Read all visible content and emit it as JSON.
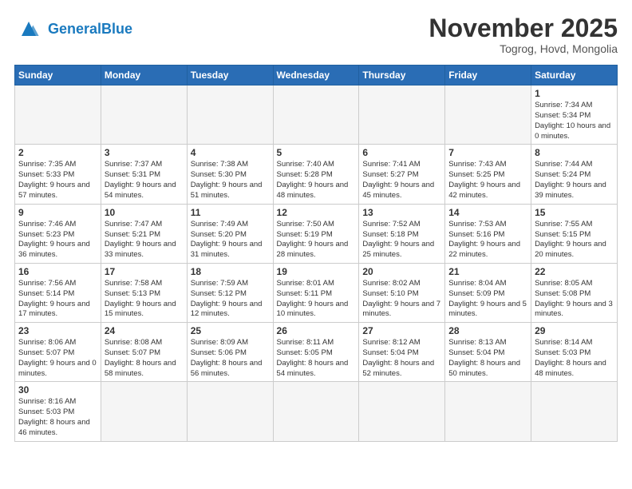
{
  "header": {
    "logo_general": "General",
    "logo_blue": "Blue",
    "month_title": "November 2025",
    "location": "Togrog, Hovd, Mongolia"
  },
  "weekdays": [
    "Sunday",
    "Monday",
    "Tuesday",
    "Wednesday",
    "Thursday",
    "Friday",
    "Saturday"
  ],
  "days": [
    {
      "num": "",
      "info": "",
      "empty": true
    },
    {
      "num": "",
      "info": "",
      "empty": true
    },
    {
      "num": "",
      "info": "",
      "empty": true
    },
    {
      "num": "",
      "info": "",
      "empty": true
    },
    {
      "num": "",
      "info": "",
      "empty": true
    },
    {
      "num": "",
      "info": "",
      "empty": true
    },
    {
      "num": "1",
      "info": "Sunrise: 7:34 AM\nSunset: 5:34 PM\nDaylight: 10 hours and 0 minutes."
    },
    {
      "num": "2",
      "info": "Sunrise: 7:35 AM\nSunset: 5:33 PM\nDaylight: 9 hours and 57 minutes."
    },
    {
      "num": "3",
      "info": "Sunrise: 7:37 AM\nSunset: 5:31 PM\nDaylight: 9 hours and 54 minutes."
    },
    {
      "num": "4",
      "info": "Sunrise: 7:38 AM\nSunset: 5:30 PM\nDaylight: 9 hours and 51 minutes."
    },
    {
      "num": "5",
      "info": "Sunrise: 7:40 AM\nSunset: 5:28 PM\nDaylight: 9 hours and 48 minutes."
    },
    {
      "num": "6",
      "info": "Sunrise: 7:41 AM\nSunset: 5:27 PM\nDaylight: 9 hours and 45 minutes."
    },
    {
      "num": "7",
      "info": "Sunrise: 7:43 AM\nSunset: 5:25 PM\nDaylight: 9 hours and 42 minutes."
    },
    {
      "num": "8",
      "info": "Sunrise: 7:44 AM\nSunset: 5:24 PM\nDaylight: 9 hours and 39 minutes."
    },
    {
      "num": "9",
      "info": "Sunrise: 7:46 AM\nSunset: 5:23 PM\nDaylight: 9 hours and 36 minutes."
    },
    {
      "num": "10",
      "info": "Sunrise: 7:47 AM\nSunset: 5:21 PM\nDaylight: 9 hours and 33 minutes."
    },
    {
      "num": "11",
      "info": "Sunrise: 7:49 AM\nSunset: 5:20 PM\nDaylight: 9 hours and 31 minutes."
    },
    {
      "num": "12",
      "info": "Sunrise: 7:50 AM\nSunset: 5:19 PM\nDaylight: 9 hours and 28 minutes."
    },
    {
      "num": "13",
      "info": "Sunrise: 7:52 AM\nSunset: 5:18 PM\nDaylight: 9 hours and 25 minutes."
    },
    {
      "num": "14",
      "info": "Sunrise: 7:53 AM\nSunset: 5:16 PM\nDaylight: 9 hours and 22 minutes."
    },
    {
      "num": "15",
      "info": "Sunrise: 7:55 AM\nSunset: 5:15 PM\nDaylight: 9 hours and 20 minutes."
    },
    {
      "num": "16",
      "info": "Sunrise: 7:56 AM\nSunset: 5:14 PM\nDaylight: 9 hours and 17 minutes."
    },
    {
      "num": "17",
      "info": "Sunrise: 7:58 AM\nSunset: 5:13 PM\nDaylight: 9 hours and 15 minutes."
    },
    {
      "num": "18",
      "info": "Sunrise: 7:59 AM\nSunset: 5:12 PM\nDaylight: 9 hours and 12 minutes."
    },
    {
      "num": "19",
      "info": "Sunrise: 8:01 AM\nSunset: 5:11 PM\nDaylight: 9 hours and 10 minutes."
    },
    {
      "num": "20",
      "info": "Sunrise: 8:02 AM\nSunset: 5:10 PM\nDaylight: 9 hours and 7 minutes."
    },
    {
      "num": "21",
      "info": "Sunrise: 8:04 AM\nSunset: 5:09 PM\nDaylight: 9 hours and 5 minutes."
    },
    {
      "num": "22",
      "info": "Sunrise: 8:05 AM\nSunset: 5:08 PM\nDaylight: 9 hours and 3 minutes."
    },
    {
      "num": "23",
      "info": "Sunrise: 8:06 AM\nSunset: 5:07 PM\nDaylight: 9 hours and 0 minutes."
    },
    {
      "num": "24",
      "info": "Sunrise: 8:08 AM\nSunset: 5:07 PM\nDaylight: 8 hours and 58 minutes."
    },
    {
      "num": "25",
      "info": "Sunrise: 8:09 AM\nSunset: 5:06 PM\nDaylight: 8 hours and 56 minutes."
    },
    {
      "num": "26",
      "info": "Sunrise: 8:11 AM\nSunset: 5:05 PM\nDaylight: 8 hours and 54 minutes."
    },
    {
      "num": "27",
      "info": "Sunrise: 8:12 AM\nSunset: 5:04 PM\nDaylight: 8 hours and 52 minutes."
    },
    {
      "num": "28",
      "info": "Sunrise: 8:13 AM\nSunset: 5:04 PM\nDaylight: 8 hours and 50 minutes."
    },
    {
      "num": "29",
      "info": "Sunrise: 8:14 AM\nSunset: 5:03 PM\nDaylight: 8 hours and 48 minutes."
    },
    {
      "num": "30",
      "info": "Sunrise: 8:16 AM\nSunset: 5:03 PM\nDaylight: 8 hours and 46 minutes."
    },
    {
      "num": "",
      "info": "",
      "empty": true
    },
    {
      "num": "",
      "info": "",
      "empty": true
    },
    {
      "num": "",
      "info": "",
      "empty": true
    },
    {
      "num": "",
      "info": "",
      "empty": true
    },
    {
      "num": "",
      "info": "",
      "empty": true
    },
    {
      "num": "",
      "info": "",
      "empty": true
    }
  ]
}
